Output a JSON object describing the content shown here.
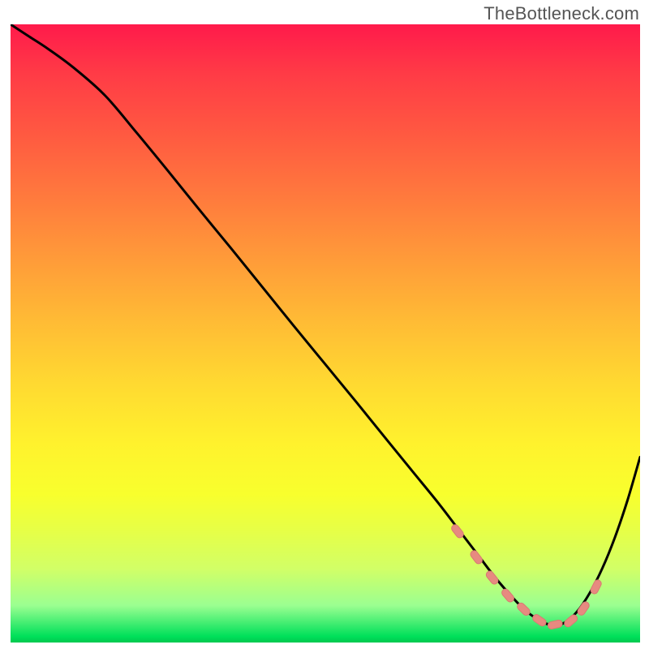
{
  "watermark": "TheBottleneck.com",
  "colors": {
    "curve": "#000000",
    "marker_fill": "#e78a80",
    "marker_stroke": "#d87b72"
  },
  "chart_data": {
    "type": "line",
    "title": "",
    "xlabel": "",
    "ylabel": "",
    "xlim": [
      0,
      100
    ],
    "ylim": [
      0,
      100
    ],
    "grid": false,
    "series": [
      {
        "name": "bottleneck_curve",
        "x": [
          0,
          3,
          6,
          10,
          15,
          20,
          25,
          30,
          35,
          40,
          45,
          50,
          55,
          60,
          64,
          68,
          71,
          74,
          77,
          80,
          82,
          84,
          86,
          88,
          90,
          92,
          94,
          96,
          98,
          100
        ],
        "y": [
          100,
          98,
          96,
          93,
          88.5,
          82.5,
          76.3,
          70,
          63.8,
          57.5,
          51.2,
          45,
          38.8,
          32.5,
          27.5,
          22.5,
          18.5,
          14.5,
          10.5,
          7,
          5,
          3.6,
          2.8,
          3.2,
          5,
          8,
          12,
          17,
          23,
          30
        ]
      }
    ],
    "markers": {
      "name": "valley_markers",
      "x": [
        71,
        74,
        76.5,
        79,
        81.5,
        84,
        86.5,
        89,
        91,
        93
      ],
      "y": [
        18.0,
        13.8,
        10.5,
        7.6,
        5.4,
        3.6,
        2.9,
        3.5,
        5.5,
        9.0
      ]
    }
  }
}
